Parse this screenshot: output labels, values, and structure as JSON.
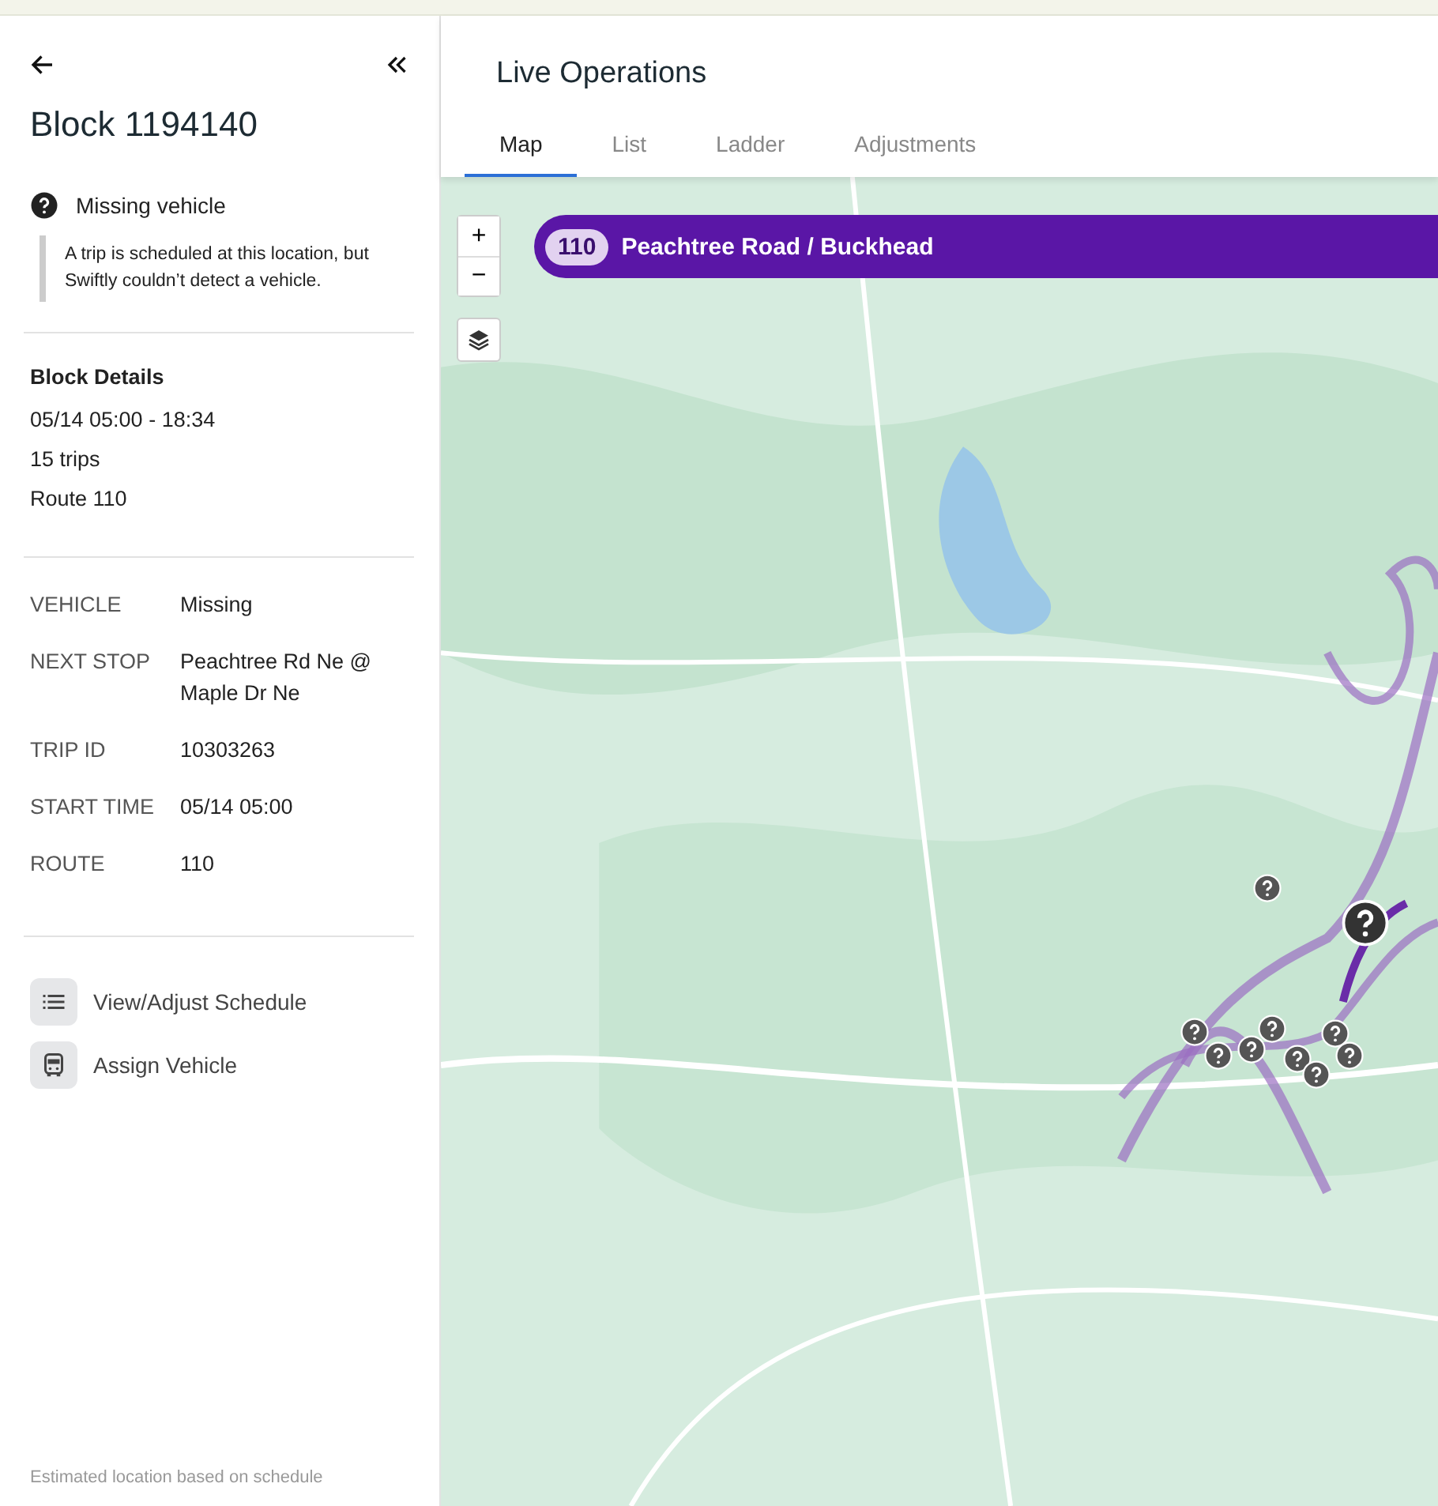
{
  "panel": {
    "title": "Block 1194140",
    "status": {
      "label": "Missing vehicle",
      "description": "A trip is scheduled at this location, but Swiftly couldn’t detect a vehicle."
    },
    "block_details": {
      "heading": "Block Details",
      "lines": [
        "05/14 05:00 - 18:34",
        "15 trips",
        "Route 110"
      ]
    },
    "fields": [
      {
        "label": "VEHICLE",
        "value": "Missing"
      },
      {
        "label": "NEXT STOP",
        "value": "Peachtree Rd Ne @ Maple Dr Ne"
      },
      {
        "label": "TRIP ID",
        "value": "10303263"
      },
      {
        "label": "START TIME",
        "value": "05/14 05:00"
      },
      {
        "label": "ROUTE",
        "value": "110"
      }
    ],
    "actions": [
      {
        "kind": "schedule",
        "label": "View/Adjust Schedule"
      },
      {
        "kind": "vehicle",
        "label": "Assign Vehicle"
      }
    ],
    "footnote": "Estimated location based on schedule"
  },
  "header": {
    "title": "Live Operations"
  },
  "tabs": [
    {
      "label": "Map",
      "selected": true
    },
    {
      "label": "List",
      "selected": false
    },
    {
      "label": "Ladder",
      "selected": false
    },
    {
      "label": "Adjustments",
      "selected": false
    }
  ],
  "map": {
    "kind": "picture",
    "zoom_in": "+",
    "zoom_out": "−",
    "route_banner": {
      "number": "110",
      "name": "Peachtree Road / Buckhead"
    }
  }
}
